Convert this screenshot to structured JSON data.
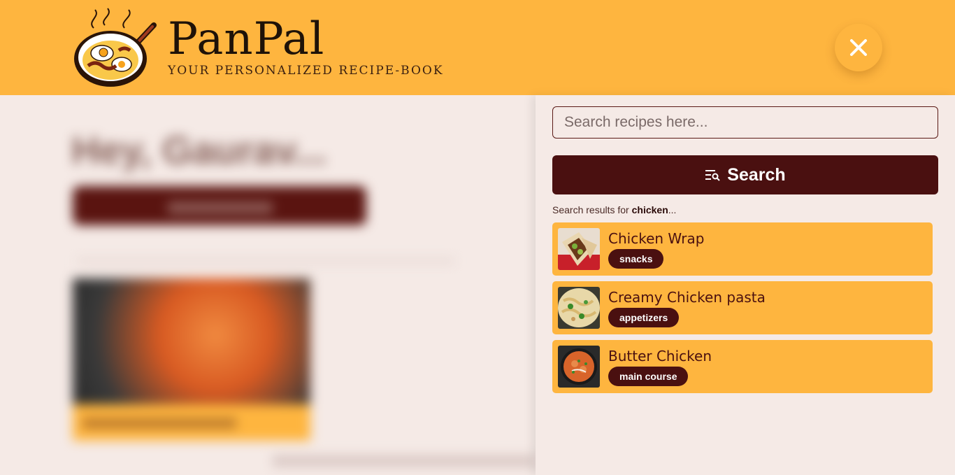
{
  "header": {
    "brand": "PanPal",
    "tagline": "Your personalized recipe-book",
    "close_icon": "close-icon",
    "bg_color": "#feb53f"
  },
  "background": {
    "greeting": "Hey, Gaurav..."
  },
  "search": {
    "placeholder": "Search recipes here...",
    "button_label": "Search",
    "button_icon": "search-list-icon",
    "results_prefix": "Search results for ",
    "query": "chicken",
    "results_suffix": "..."
  },
  "results": [
    {
      "title": "Chicken Wrap",
      "tag": "snacks",
      "thumb": "chicken-wrap-image"
    },
    {
      "title": "Creamy Chicken pasta",
      "tag": "appetizers",
      "thumb": "chicken-pasta-image"
    },
    {
      "title": "Butter Chicken",
      "tag": "main course",
      "thumb": "butter-chicken-image"
    }
  ],
  "colors": {
    "accent": "#feb53f",
    "dark": "#4a1010",
    "page_bg": "#f5eae6"
  }
}
